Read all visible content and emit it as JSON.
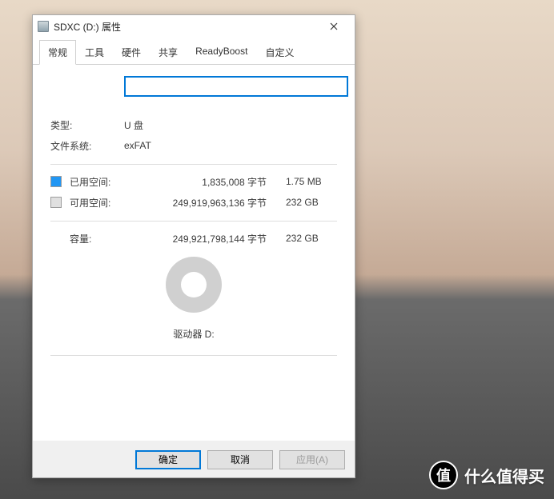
{
  "window": {
    "title": "SDXC (D:) 属性"
  },
  "tabs": [
    "常规",
    "工具",
    "硬件",
    "共享",
    "ReadyBoost",
    "自定义"
  ],
  "active_tab": 0,
  "general": {
    "name_value": "",
    "type_label": "类型:",
    "type_value": "U 盘",
    "fs_label": "文件系统:",
    "fs_value": "exFAT",
    "used_label": "已用空间:",
    "used_bytes": "1,835,008 字节",
    "used_human": "1.75 MB",
    "used_color": "#2196f3",
    "free_label": "可用空间:",
    "free_bytes": "249,919,963,136 字节",
    "free_human": "232 GB",
    "free_color": "#e0e0e0",
    "capacity_label": "容量:",
    "capacity_bytes": "249,921,798,144 字节",
    "capacity_human": "232 GB",
    "drive_label": "驱动器 D:"
  },
  "buttons": {
    "ok": "确定",
    "cancel": "取消",
    "apply": "应用(A)"
  },
  "watermark": {
    "logo": "值",
    "text": "什么值得买"
  }
}
